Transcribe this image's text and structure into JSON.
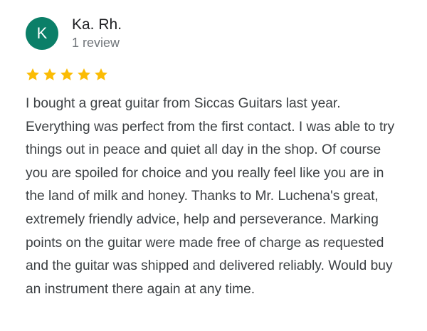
{
  "reviewer": {
    "initial": "K",
    "name": "Ka. Rh.",
    "review_count": "1 review",
    "avatar_color": "#0b7f68"
  },
  "rating": {
    "stars": 5,
    "max": 5,
    "star_icon": "star-icon",
    "star_color": "#fbbc04"
  },
  "review": {
    "text": "I bought a great guitar from Siccas Guitars last year. Everything was perfect from the first contact. I was able to try things out in peace and quiet all day in the shop. Of course you are spoiled for choice and you really feel like you are in the land of milk and honey. Thanks to Mr. Luchena's great, extremely friendly advice, help and perseverance. Marking points on the guitar were made free of charge as requested and the guitar was shipped and delivered reliably. Would buy an instrument there again at any time."
  }
}
